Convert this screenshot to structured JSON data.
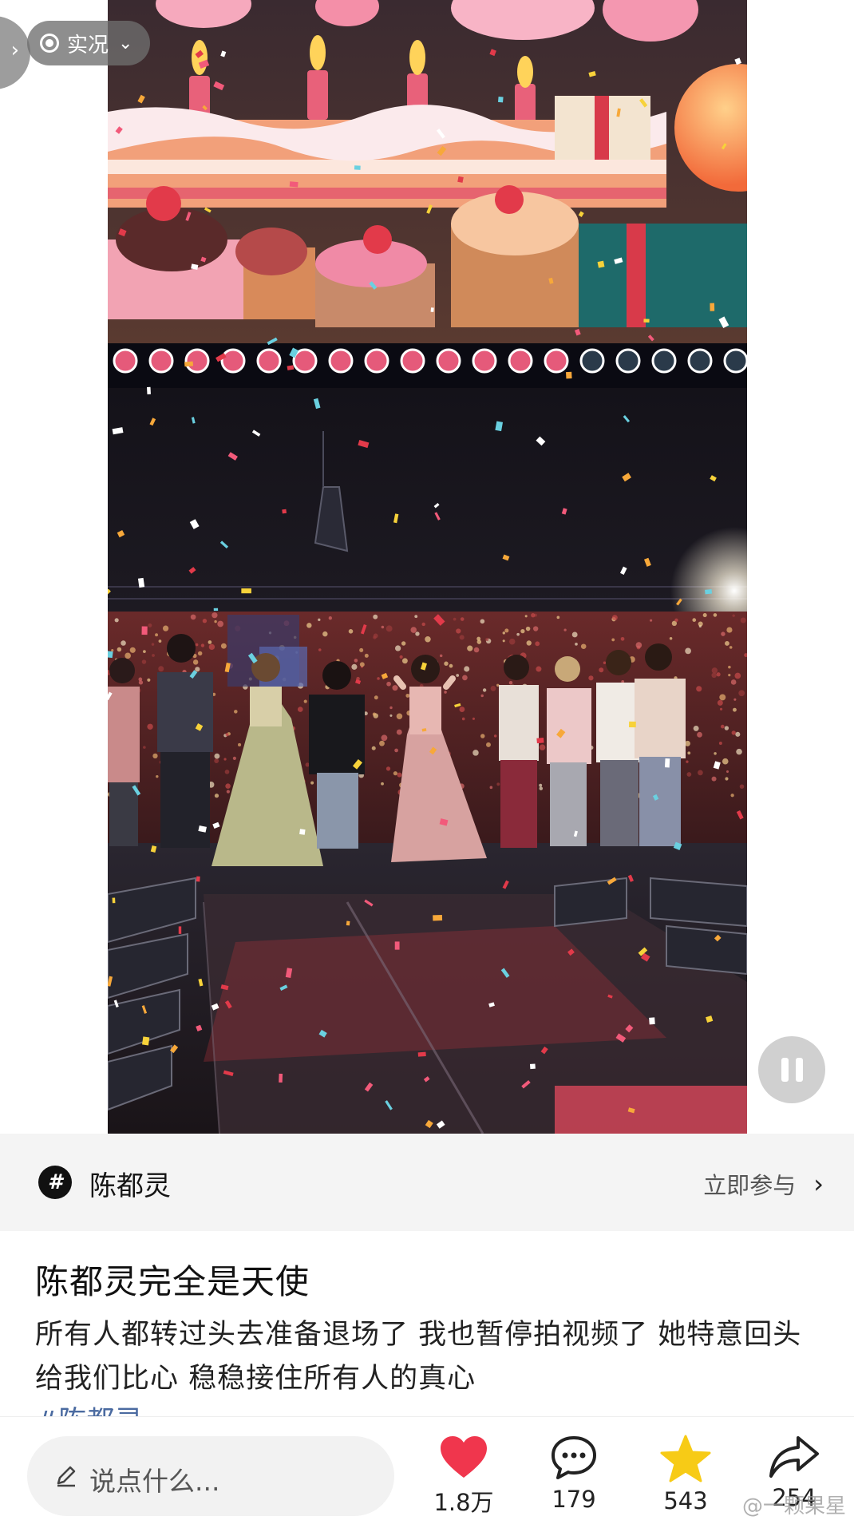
{
  "live_badge": {
    "label": "实况"
  },
  "topic": {
    "name": "陈都灵",
    "join_label": "立即参与"
  },
  "post": {
    "title": "陈都灵完全是天使",
    "body": "所有人都转过头去准备退场了 我也暂停拍视频了 她特意回头给我们比心 稳稳接住所有人的真心",
    "hashtag": "#陈都灵"
  },
  "comment_bar": {
    "placeholder": "说点什么..."
  },
  "actions": {
    "like_count": "1.8万",
    "comment_count": "179",
    "favorite_count": "543",
    "share_count": "254"
  },
  "watermark": "@一颗果星",
  "colors": {
    "like": "#f0364d",
    "favorite": "#f7cb16",
    "hashtag": "#4a6aa0"
  },
  "icons": [
    "live-icon",
    "pause-icon",
    "scan-icon",
    "topic-hash-icon",
    "chevron-right-icon",
    "pencil-icon",
    "heart-icon",
    "comment-icon",
    "star-icon",
    "share-icon"
  ]
}
